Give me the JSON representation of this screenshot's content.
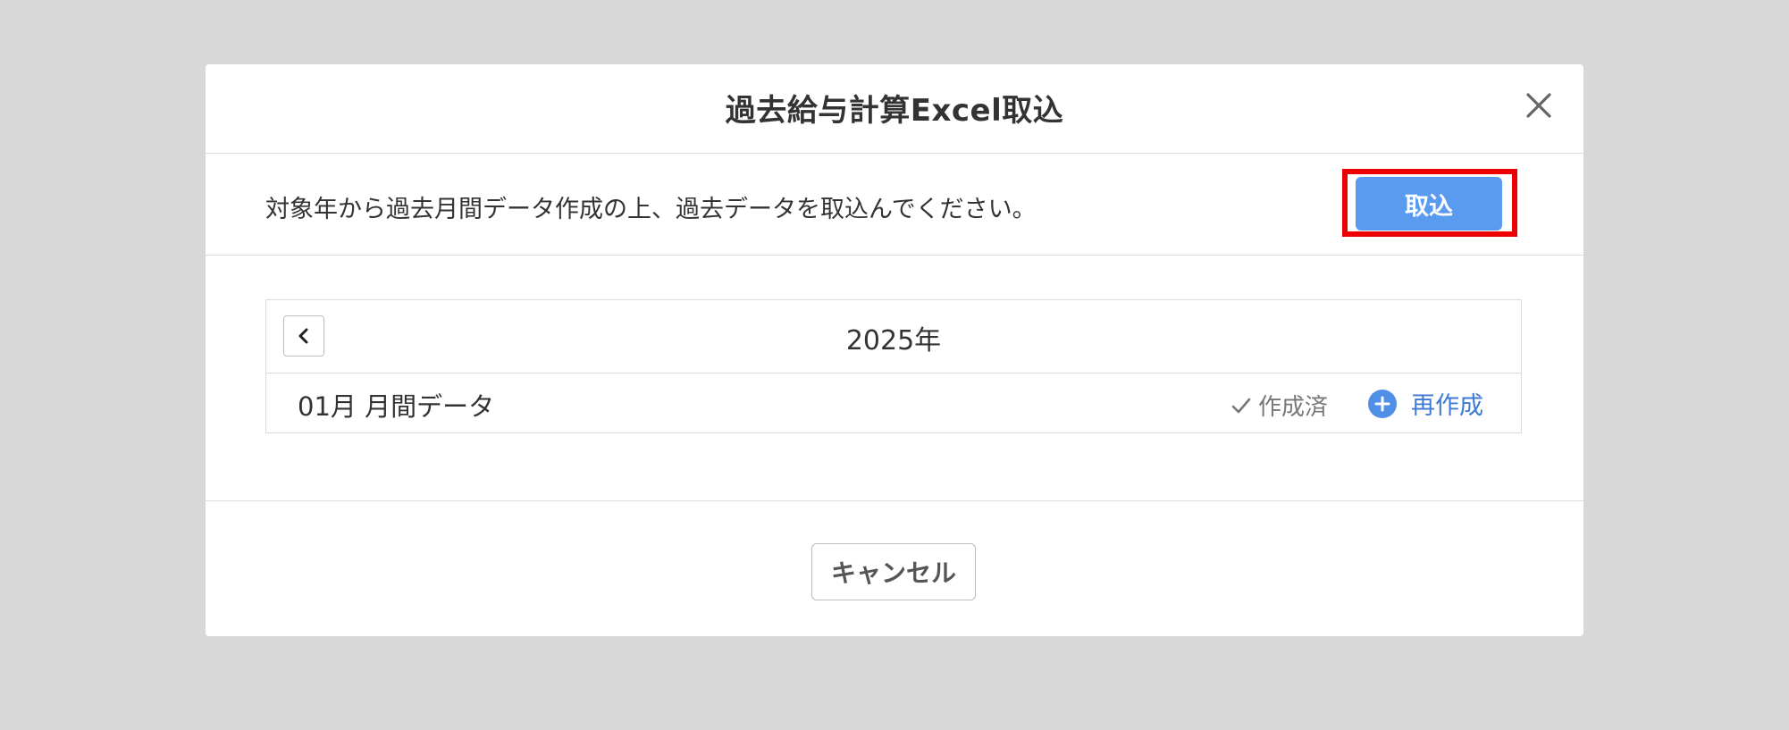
{
  "dialog": {
    "title": "過去給与計算Excel取込",
    "close_icon": "close-icon"
  },
  "action_row": {
    "instruction": "対象年から過去月間データ作成の上、過去データを取込んでください。",
    "import_label": "取込",
    "import_color": "#5b9bef",
    "highlight_color": "#ee0000"
  },
  "year_panel": {
    "prev_icon": "chevron-left-icon",
    "year_label": "2025年",
    "rows": [
      {
        "month_label": "01月 月間データ",
        "status_icon": "check-icon",
        "status_label": "作成済",
        "recreate_icon": "plus-circle-icon",
        "recreate_label": "再作成"
      }
    ]
  },
  "footer": {
    "cancel_label": "キャンセル"
  }
}
